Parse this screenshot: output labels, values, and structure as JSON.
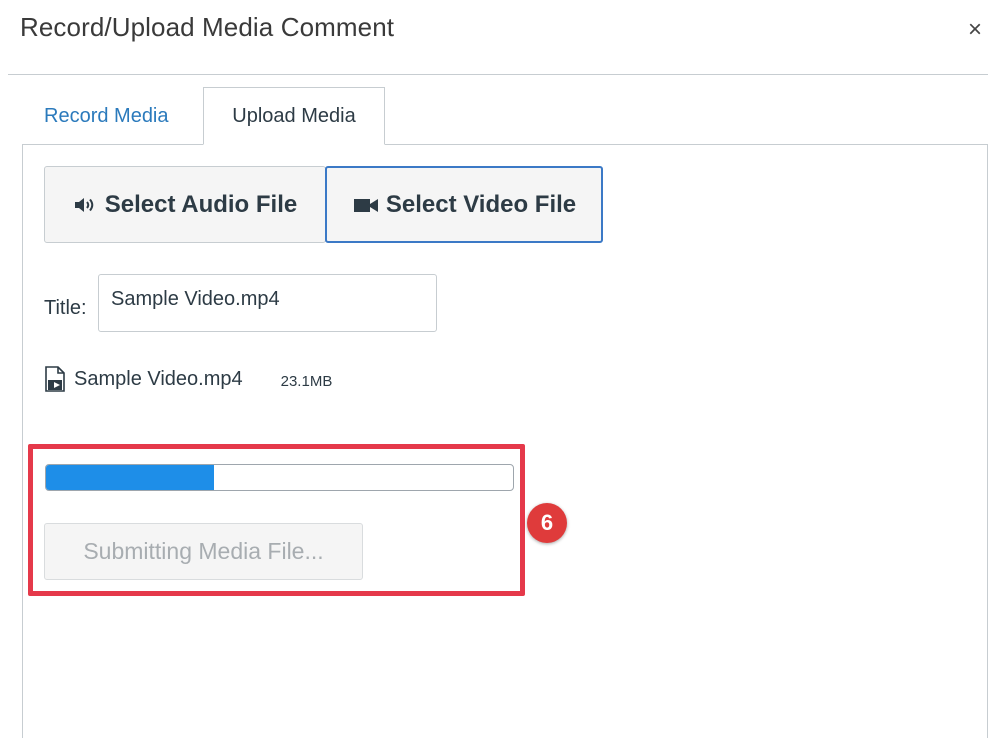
{
  "dialog": {
    "title": "Record/Upload Media Comment",
    "close_glyph": "×"
  },
  "tabs": [
    {
      "label": "Record Media",
      "active": false
    },
    {
      "label": "Upload Media",
      "active": true
    }
  ],
  "buttons": {
    "audio": {
      "label": "Select Audio File",
      "icon": "speaker-icon"
    },
    "video": {
      "label": "Select Video File",
      "icon": "video-camera-icon"
    }
  },
  "title_field": {
    "label": "Title:",
    "value": "Sample Video.mp4"
  },
  "file": {
    "icon": "video-file-icon",
    "name": "Sample Video.mp4",
    "size": "23.1MB"
  },
  "upload": {
    "progress_fraction": 0.36,
    "submit_label": "Submitting Media File..."
  },
  "annotation": {
    "step_number": "6",
    "color": "#e5394a"
  },
  "colors": {
    "link": "#2b7abc",
    "progress": "#1e8ee8",
    "focus_border": "#3b79c6"
  }
}
